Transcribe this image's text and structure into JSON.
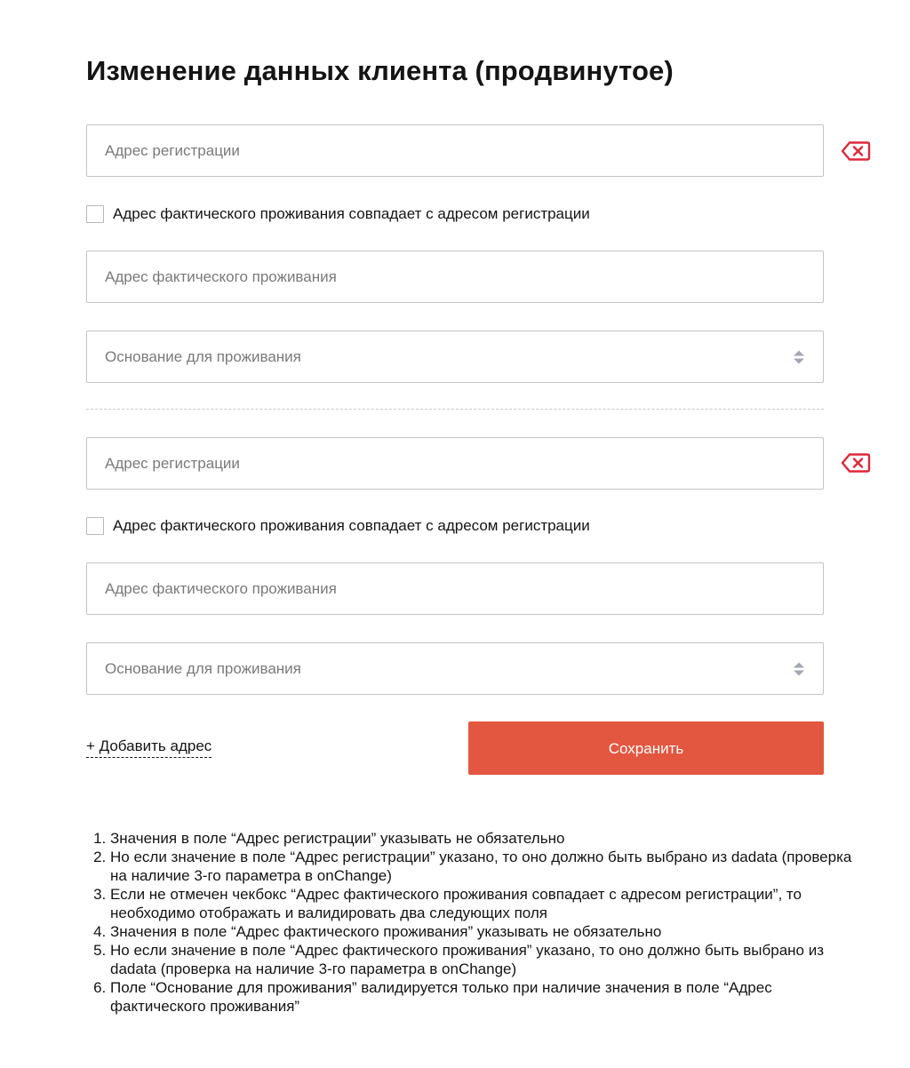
{
  "page": {
    "title": "Изменение данных клиента (продвинутое)"
  },
  "address_blocks": [
    {
      "registration_placeholder": "Адрес регистрации",
      "checkbox_label": "Адрес фактического проживания совпадает с адресом регистрации",
      "checkbox_checked": false,
      "actual_placeholder": "Адрес фактического проживания",
      "basis_placeholder": "Основание для проживания"
    },
    {
      "registration_placeholder": "Адрес регистрации",
      "checkbox_label": "Адрес фактического проживания совпадает с адресом регистрации",
      "checkbox_checked": false,
      "actual_placeholder": "Адрес фактического проживания",
      "basis_placeholder": "Основание для проживания"
    }
  ],
  "actions": {
    "add_address_label": "+ Добавить адрес",
    "save_label": "Сохранить"
  },
  "notes": [
    "Значения в поле “Адрес регистрации” указывать не обязательно",
    "Но если значение в поле “Адрес регистрации” указано, то оно должно быть выбрано из dadata (проверка на наличие 3-го параметра в onChange)",
    "Если не отмечен чекбокс “Адрес фактического проживания совпадает с адресом регистрации”, то необходимо отображать и валидировать два следующих поля",
    "Значения в поле “Адрес фактического проживания” указывать не обязательно",
    "Но если значение в поле “Адрес фактического проживания” указано, то оно должно быть выбрано из dadata (проверка на наличие 3-го параметра в onChange)",
    "Поле “Основание для проживания” валидируется только при наличие значения в поле “Адрес фактического проживания”"
  ],
  "icons": {
    "delete": "backspace-delete-icon",
    "select_arrows": "sort-arrows-icon"
  },
  "colors": {
    "accent": "#e35640",
    "delete_icon": "#e0273a",
    "field_border": "#c4c4c4",
    "placeholder": "#7a7a7a",
    "select_arrows": "#a0a8b2"
  }
}
